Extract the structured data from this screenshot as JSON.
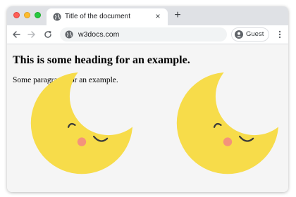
{
  "window": {
    "controls": [
      "close",
      "minimize",
      "maximize"
    ]
  },
  "tab": {
    "title": "Title of the document",
    "favicon": "globe-icon",
    "close_label": "×"
  },
  "new_tab_label": "+",
  "toolbar": {
    "back_icon": "arrow-left-icon",
    "forward_icon": "arrow-right-icon",
    "reload_icon": "reload-icon",
    "url": "w3docs.com",
    "site_icon": "globe-icon",
    "profile_label": "Guest",
    "menu_icon": "three-dots-vertical-icon"
  },
  "page": {
    "heading": "This is some heading for an example.",
    "paragraph": "Some paragraph for an example.",
    "images": [
      "sleeping-moon-image",
      "sleeping-moon-image"
    ]
  },
  "colors": {
    "moon": "#f7dc4a",
    "cheek": "#f4937b",
    "face_line": "#3a3a3a",
    "tab_strip": "#dfe1e5",
    "page_bg": "#f5f5f5"
  }
}
